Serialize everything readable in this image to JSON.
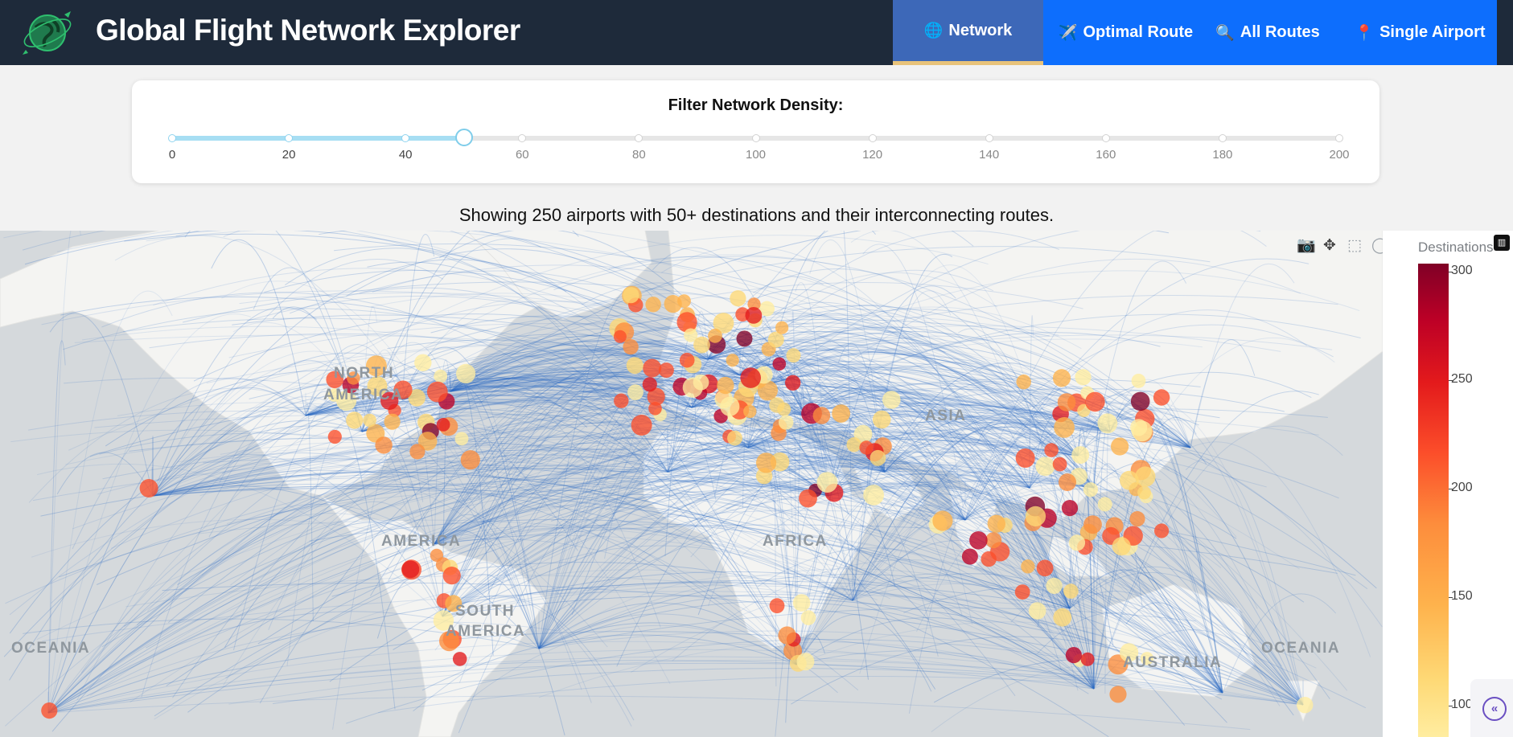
{
  "header": {
    "title": "Global Flight Network Explorer",
    "logo_icon": "globe-plane-icon",
    "tabs": [
      {
        "label": "Network",
        "icon": "🌐",
        "active": true
      },
      {
        "label": "Optimal Route",
        "icon": "✈️",
        "active": false
      },
      {
        "label": "All Routes",
        "icon": "🔍",
        "active": false
      },
      {
        "label": "Single Airport",
        "icon": "📍",
        "active": false
      }
    ],
    "active_tab_color": "#3d68b8",
    "nav_color": "#0d6efd",
    "header_bg": "#1e2a3a"
  },
  "filter": {
    "title": "Filter Network Density:",
    "min": 0,
    "max": 200,
    "value": 50,
    "marks": [
      "0",
      "20",
      "40",
      "60",
      "80",
      "100",
      "120",
      "140",
      "160",
      "180",
      "200"
    ]
  },
  "caption": "Showing 250 airports with 50+ destinations and their interconnecting routes.",
  "map": {
    "labels": {
      "north_america": "NORTH AMERICA",
      "south_america": "SOUTH AMERICA",
      "africa": "AFRICA",
      "asia": "ASIA",
      "australia": "AUSTRALIA",
      "oceania": "OCEANIA",
      "america_fragment": "AMERICA"
    },
    "route_color": "#2d6cc4",
    "land_color": "#f4f4f2",
    "water_color": "#d5d9dc"
  },
  "colorbar": {
    "title": "Destinations",
    "ticks": [
      "300",
      "250",
      "200",
      "150",
      "100"
    ]
  },
  "modebar": [
    "camera-icon",
    "pan-icon",
    "box-select-icon",
    "lasso-icon",
    "zoom-in-icon",
    "zoom-out-icon",
    "reset-icon",
    "plotly-logo-icon"
  ],
  "toggle": {
    "icon": "«"
  }
}
